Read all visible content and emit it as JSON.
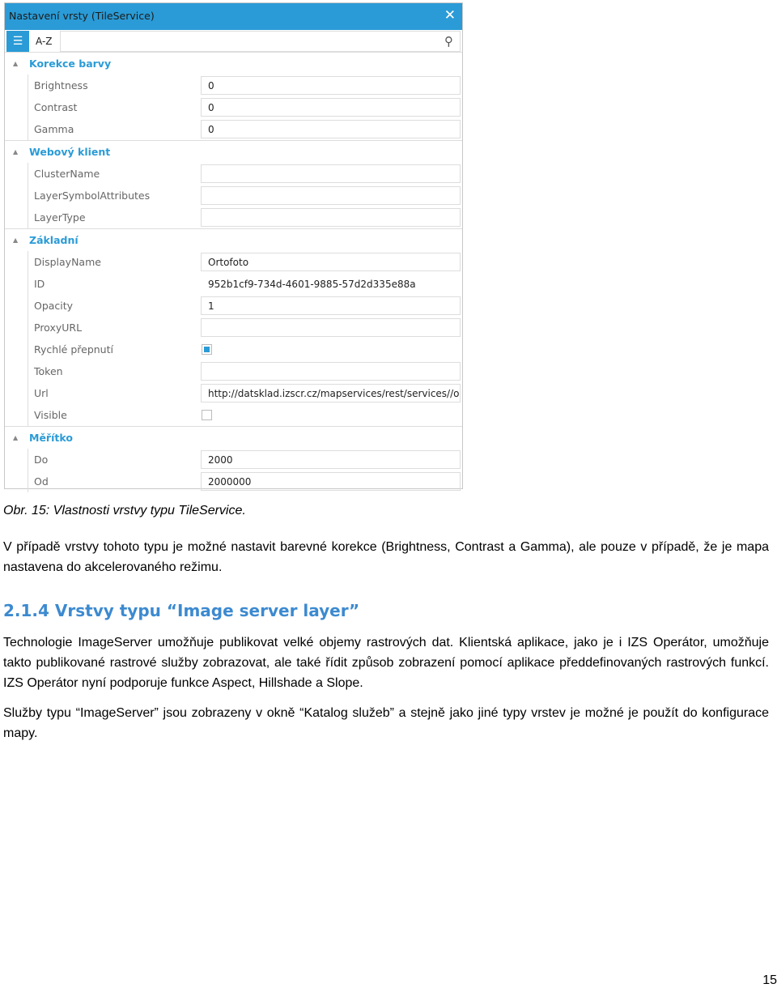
{
  "dialog": {
    "title": "Nastavení vrsty (TileService)",
    "close_icon": "close-icon",
    "toolbar": {
      "categorized_icon": "categorized-list-icon",
      "az_label": "A-Z",
      "search_placeholder": "",
      "search_icon": "search-icon"
    },
    "sections": [
      {
        "title": "Korekce barvy",
        "rows": [
          {
            "label": "Brightness",
            "value": "0"
          },
          {
            "label": "Contrast",
            "value": "0"
          },
          {
            "label": "Gamma",
            "value": "0"
          }
        ]
      },
      {
        "title": "Webový klient",
        "rows": [
          {
            "label": "ClusterName",
            "value": ""
          },
          {
            "label": "LayerSymbolAttributes",
            "value": ""
          },
          {
            "label": "LayerType",
            "value": ""
          }
        ]
      },
      {
        "title": "Základní",
        "rows": [
          {
            "label": "DisplayName",
            "value": "Ortofoto"
          },
          {
            "label": "ID",
            "value": "952b1cf9-734d-4601-9885-57d2d335e88a",
            "readonly": true
          },
          {
            "label": "Opacity",
            "value": "1"
          },
          {
            "label": "ProxyURL",
            "value": ""
          },
          {
            "label": "Rychlé přepnutí",
            "checkbox": true,
            "checked": true
          },
          {
            "label": "Token",
            "value": ""
          },
          {
            "label": "Url",
            "value": "http://datsklad.izscr.cz/mapservices/rest/services//ortc"
          },
          {
            "label": "Visible",
            "checkbox": true,
            "checked": false
          }
        ]
      },
      {
        "title": "Měřítko",
        "rows": [
          {
            "label": "Do",
            "value": "2000"
          },
          {
            "label": "Od",
            "value": "2000000"
          }
        ]
      }
    ],
    "accent": "#2a9bd6"
  },
  "caption": "Obr. 15: Vlastnosti vrstvy typu TileService.",
  "para1": "V případě vrstvy tohoto typu je možné nastavit barevné korekce (Brightness, Contrast a Gamma), ale pouze v případě, že je mapa nastavena do akcelerovaného režimu.",
  "heading": "2.1.4 Vrstvy typu “Image server layer”",
  "para2": "Technologie ImageServer umožňuje publikovat velké objemy rastrových dat. Klientská aplikace, jako je i IZS Operátor, umožňuje takto publikované rastrové služby zobrazovat, ale také řídit způsob zobrazení pomocí aplikace předdefinovaných rastrových funkcí. IZS Operátor nyní podporuje funkce Aspect, Hillshade a Slope.",
  "para3": "Služby typu “ImageServer” jsou zobrazeny v okně “Katalog služeb” a stejně jako jiné typy vrstev je možné je použít do konfigurace mapy.",
  "page_number": "15"
}
